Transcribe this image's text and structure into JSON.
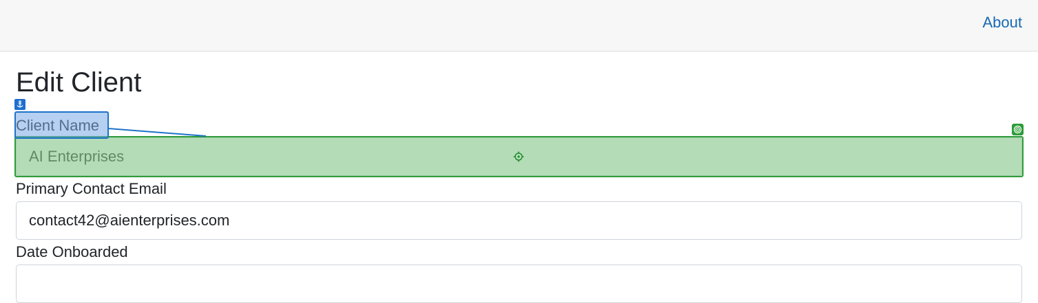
{
  "navbar": {
    "about_label": "About"
  },
  "page": {
    "title": "Edit Client"
  },
  "form": {
    "client_name_label": "Client Name",
    "client_name_value": "AI Enterprises",
    "email_label": "Primary Contact Email",
    "email_value": "contact42@aienterprises.com",
    "date_label": "Date Onboarded",
    "date_value": ""
  },
  "colors": {
    "link": "#1769b4",
    "highlight_field": "#2e9c3a",
    "highlight_label": "#1d72c9"
  },
  "overlay_icons": [
    "anchor-icon",
    "target-icon",
    "crosshair-icon"
  ]
}
